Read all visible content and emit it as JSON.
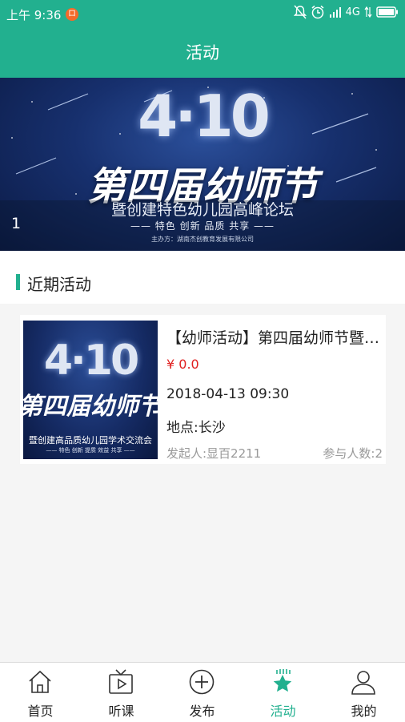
{
  "status_bar": {
    "time": "上午 9:36",
    "notification_badge": "ロ",
    "network": "4G"
  },
  "app_bar": {
    "title": "活动"
  },
  "banner": {
    "date_text": "4·10",
    "title": "第四届幼师节",
    "subtitle": "暨创建特色幼儿园高峰论坛",
    "tags": "—— 特色 创新 品质 共享 ——",
    "host": "主办方：湖南杰创教育发展有限公司",
    "index": "1"
  },
  "section": {
    "title": "近期活动"
  },
  "activities": [
    {
      "thumb": {
        "date_text": "4·10",
        "title": "第四届幼师节",
        "subtitle": "暨创建高品质幼儿园学术交流会",
        "tags": "—— 特色 创新 提质 效益 共享 ——"
      },
      "title": "【幼师活动】第四届幼师节暨创建特色幼儿园高峰论坛",
      "price": "¥ 0.0",
      "datetime": "2018-04-13 09:30",
      "location": "地点:长沙",
      "organizer": "发起人:显百2211",
      "participants": "参与人数:2"
    }
  ],
  "nav": [
    {
      "label": "首页",
      "icon": "home-icon"
    },
    {
      "label": "听课",
      "icon": "tv-play-icon"
    },
    {
      "label": "发布",
      "icon": "plus-circle-icon"
    },
    {
      "label": "活动",
      "icon": "star-icon",
      "active": true
    },
    {
      "label": "我的",
      "icon": "user-icon"
    }
  ],
  "colors": {
    "primary": "#22b08f",
    "price": "#e02020"
  }
}
